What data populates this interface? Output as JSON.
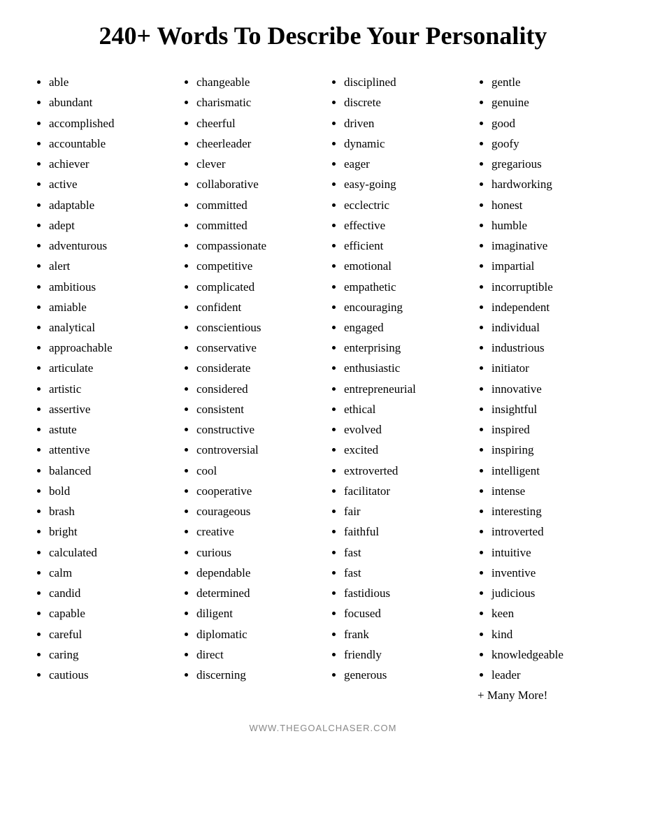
{
  "title": "240+ Words To Describe Your Personality",
  "columns": [
    {
      "id": "col1",
      "items": [
        "able",
        "abundant",
        "accomplished",
        "accountable",
        "achiever",
        "active",
        "adaptable",
        "adept",
        "adventurous",
        "alert",
        "ambitious",
        "amiable",
        "analytical",
        "approachable",
        "articulate",
        "artistic",
        "assertive",
        "astute",
        "attentive",
        "balanced",
        "bold",
        "brash",
        "bright",
        "calculated",
        "calm",
        "candid",
        "capable",
        "careful",
        "caring",
        "cautious"
      ]
    },
    {
      "id": "col2",
      "items": [
        "changeable",
        "charismatic",
        "cheerful",
        "cheerleader",
        "clever",
        "collaborative",
        "committed",
        "committed",
        "compassionate",
        "competitive",
        "complicated",
        "confident",
        "conscientious",
        "conservative",
        "considerate",
        "considered",
        "consistent",
        "constructive",
        "controversial",
        "cool",
        "cooperative",
        "courageous",
        "creative",
        "curious",
        "dependable",
        "determined",
        "diligent",
        "diplomatic",
        "direct",
        "discerning"
      ]
    },
    {
      "id": "col3",
      "items": [
        "disciplined",
        "discrete",
        "driven",
        "dynamic",
        "eager",
        "easy-going",
        "ecclectric",
        "effective",
        "efficient",
        "emotional",
        "empathetic",
        "encouraging",
        "engaged",
        "enterprising",
        "enthusiastic",
        "entrepreneurial",
        "ethical",
        "evolved",
        "excited",
        "extroverted",
        "facilitator",
        "fair",
        "faithful",
        "fast",
        "fast",
        "fastidious",
        "focused",
        "frank",
        "friendly",
        "generous"
      ]
    },
    {
      "id": "col4",
      "items": [
        "gentle",
        "genuine",
        "good",
        "goofy",
        "gregarious",
        "hardworking",
        "honest",
        "humble",
        "imaginative",
        "impartial",
        "incorruptible",
        "independent",
        "individual",
        "industrious",
        "initiator",
        "innovative",
        "insightful",
        "inspired",
        "inspiring",
        "intelligent",
        "intense",
        "interesting",
        "introverted",
        "intuitive",
        "inventive",
        "judicious",
        "keen",
        "kind",
        "knowledgeable",
        "leader"
      ]
    }
  ],
  "more": "+ Many More!",
  "footer": "WWW.THEGOALCHASER.COM"
}
